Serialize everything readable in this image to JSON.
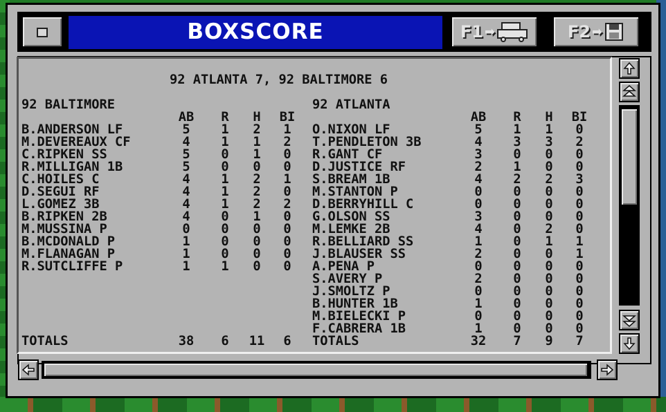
{
  "window": {
    "title": "BOXSCORE",
    "f1_label": "F1",
    "f2_label": "F2"
  },
  "header": {
    "score_line": "92 ATLANTA 7, 92 BALTIMORE 6"
  },
  "teams": [
    {
      "name": "92 BALTIMORE",
      "columns": [
        "AB",
        "R",
        "H",
        "BI"
      ],
      "players": [
        {
          "name": "B.ANDERSON LF",
          "ab": "5",
          "r": "1",
          "h": "2",
          "bi": "1"
        },
        {
          "name": "M.DEVEREAUX CF",
          "ab": "4",
          "r": "1",
          "h": "1",
          "bi": "2"
        },
        {
          "name": "C.RIPKEN SS",
          "ab": "5",
          "r": "0",
          "h": "1",
          "bi": "0"
        },
        {
          "name": "R.MILLIGAN 1B",
          "ab": "5",
          "r": "0",
          "h": "0",
          "bi": "0"
        },
        {
          "name": "C.HOILES C",
          "ab": "4",
          "r": "1",
          "h": "2",
          "bi": "1"
        },
        {
          "name": "D.SEGUI RF",
          "ab": "4",
          "r": "1",
          "h": "2",
          "bi": "0"
        },
        {
          "name": "L.GOMEZ 3B",
          "ab": "4",
          "r": "1",
          "h": "2",
          "bi": "2"
        },
        {
          "name": "B.RIPKEN 2B",
          "ab": "4",
          "r": "0",
          "h": "1",
          "bi": "0"
        },
        {
          "name": "M.MUSSINA P",
          "ab": "0",
          "r": "0",
          "h": "0",
          "bi": "0"
        },
        {
          "name": "B.MCDONALD P",
          "ab": "1",
          "r": "0",
          "h": "0",
          "bi": "0"
        },
        {
          "name": "M.FLANAGAN P",
          "ab": "1",
          "r": "0",
          "h": "0",
          "bi": "0"
        },
        {
          "name": "R.SUTCLIFFE P",
          "ab": "1",
          "r": "1",
          "h": "0",
          "bi": "0"
        }
      ],
      "totals": {
        "label": "TOTALS",
        "ab": "38",
        "r": "6",
        "h": "11",
        "bi": "6"
      }
    },
    {
      "name": "92 ATLANTA",
      "columns": [
        "AB",
        "R",
        "H",
        "BI"
      ],
      "players": [
        {
          "name": "O.NIXON LF",
          "ab": "5",
          "r": "1",
          "h": "1",
          "bi": "0"
        },
        {
          "name": "T.PENDLETON 3B",
          "ab": "4",
          "r": "3",
          "h": "3",
          "bi": "2"
        },
        {
          "name": "R.GANT CF",
          "ab": "3",
          "r": "0",
          "h": "0",
          "bi": "0"
        },
        {
          "name": "D.JUSTICE RF",
          "ab": "2",
          "r": "1",
          "h": "0",
          "bi": "0"
        },
        {
          "name": "S.BREAM 1B",
          "ab": "4",
          "r": "2",
          "h": "2",
          "bi": "3"
        },
        {
          "name": "M.STANTON P",
          "ab": "0",
          "r": "0",
          "h": "0",
          "bi": "0"
        },
        {
          "name": "D.BERRYHILL C",
          "ab": "0",
          "r": "0",
          "h": "0",
          "bi": "0"
        },
        {
          "name": "G.OLSON SS",
          "ab": "3",
          "r": "0",
          "h": "0",
          "bi": "0"
        },
        {
          "name": "M.LEMKE 2B",
          "ab": "4",
          "r": "0",
          "h": "2",
          "bi": "0"
        },
        {
          "name": "R.BELLIARD SS",
          "ab": "1",
          "r": "0",
          "h": "1",
          "bi": "1"
        },
        {
          "name": "J.BLAUSER SS",
          "ab": "2",
          "r": "0",
          "h": "0",
          "bi": "1"
        },
        {
          "name": "A.PENA P",
          "ab": "0",
          "r": "0",
          "h": "0",
          "bi": "0"
        },
        {
          "name": "S.AVERY P",
          "ab": "2",
          "r": "0",
          "h": "0",
          "bi": "0"
        },
        {
          "name": "J.SMOLTZ P",
          "ab": "0",
          "r": "0",
          "h": "0",
          "bi": "0"
        },
        {
          "name": "B.HUNTER 1B",
          "ab": "1",
          "r": "0",
          "h": "0",
          "bi": "0"
        },
        {
          "name": "M.BIELECKI P",
          "ab": "0",
          "r": "0",
          "h": "0",
          "bi": "0"
        },
        {
          "name": "F.CABRERA 1B",
          "ab": "1",
          "r": "0",
          "h": "0",
          "bi": "0"
        }
      ],
      "totals": {
        "label": "TOTALS",
        "ab": "32",
        "r": "7",
        "h": "9",
        "bi": "7"
      }
    }
  ],
  "icons": {
    "f1": "printer-icon",
    "f2": "save-disk-icon",
    "scroll_up": "arrow-up-icon",
    "scroll_page_up": "double-arrow-up-icon",
    "scroll_page_down": "double-arrow-down-icon",
    "scroll_down": "arrow-down-icon",
    "scroll_left": "arrow-left-icon",
    "scroll_right": "arrow-right-icon"
  },
  "colors": {
    "title_bar": "#0a14b4",
    "window_gray": "#b4b4b4",
    "text": "#111111"
  }
}
